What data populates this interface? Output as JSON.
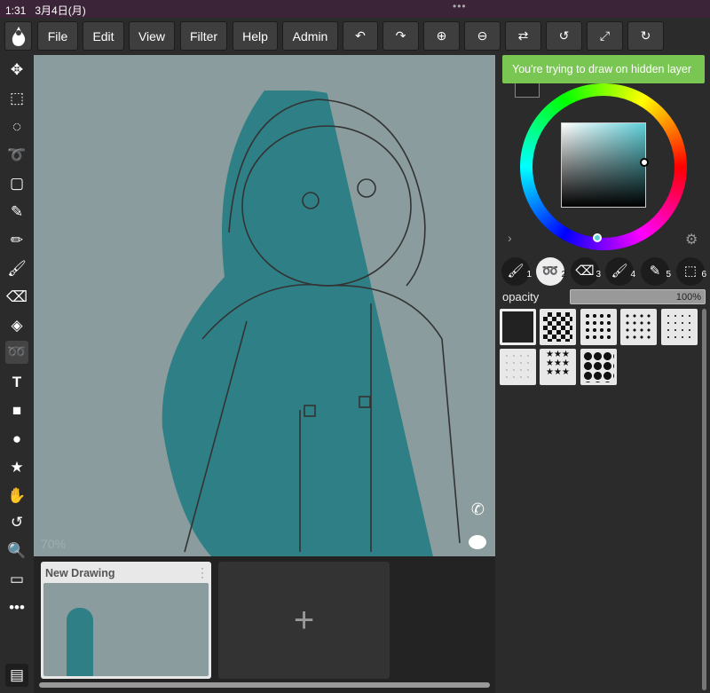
{
  "status": {
    "time": "1:31",
    "date": "3月4日(月)",
    "dots": "•••"
  },
  "menu": [
    "File",
    "Edit",
    "View",
    "Filter",
    "Help",
    "Admin"
  ],
  "toast": "You're trying to draw on hidden layer",
  "canvas": {
    "zoom": "70%"
  },
  "opacity": {
    "label": "opacity",
    "value": "100%",
    "fraction": 1.0
  },
  "brushes": [
    "1",
    "2",
    "3",
    "4",
    "5",
    "6"
  ],
  "colors": {
    "accent": "#7ac653",
    "teal": "#2f7f86",
    "canvas_bg": "#8a9c9d"
  },
  "drawings": [
    {
      "title": "New Drawing"
    }
  ],
  "add_label": "+"
}
